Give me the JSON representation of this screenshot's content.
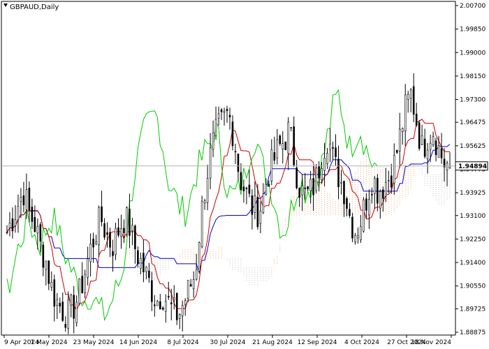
{
  "header": {
    "symbol_label": "GBPAUD,Daily"
  },
  "colors": {
    "background": "#ffffff",
    "tenkan_sen": "#cc0000",
    "kijun_sen": "#0000cc",
    "chikou_span": "#00cc00",
    "kumo_bull": "#e8a070",
    "kumo_bear": "#b8b8b8",
    "candle": "#000000",
    "current_price_line": "#b0b0b0"
  },
  "chart_data": {
    "type": "candlestick",
    "symbol": "GBPAUD",
    "timeframe": "Daily",
    "current_price": 1.94894,
    "current_price_label": "1.94894",
    "ylim": [
      1.88875,
      2.0075
    ],
    "y_ticks": [
      {
        "value": 2.007,
        "label": "2.00700"
      },
      {
        "value": 1.9985,
        "label": "1.99850"
      },
      {
        "value": 1.99,
        "label": "1.99000"
      },
      {
        "value": 1.9815,
        "label": "1.98150"
      },
      {
        "value": 1.973,
        "label": "1.97300"
      },
      {
        "value": 1.96475,
        "label": "1.96475"
      },
      {
        "value": 1.95625,
        "label": "1.95625"
      },
      {
        "value": 1.94775,
        "label": "1.94775"
      },
      {
        "value": 1.93925,
        "label": "1.93925"
      },
      {
        "value": 1.931,
        "label": "1.93100"
      },
      {
        "value": 1.9225,
        "label": "1.92250"
      },
      {
        "value": 1.914,
        "label": "1.91400"
      },
      {
        "value": 1.9055,
        "label": "1.90550"
      },
      {
        "value": 1.89725,
        "label": "1.89725"
      },
      {
        "value": 1.88875,
        "label": "1.88875"
      }
    ],
    "x_ticks": [
      {
        "label": "9 Apr 2024"
      },
      {
        "label": "1 May 2024"
      },
      {
        "label": "23 May 2024"
      },
      {
        "label": "14 Jun 2024"
      },
      {
        "label": "8 Jul 2024"
      },
      {
        "label": "30 Jul 2024"
      },
      {
        "label": "21 Aug 2024"
      },
      {
        "label": "12 Sep 2024"
      },
      {
        "label": "4 Oct 2024"
      },
      {
        "label": "27 Oct 2024"
      },
      {
        "label": "18 Nov 2024"
      }
    ],
    "close_path": [
      1.925,
      1.93,
      1.935,
      1.94,
      1.932,
      1.928,
      1.92,
      1.915,
      1.905,
      1.9,
      1.897,
      1.895,
      1.898,
      1.902,
      1.91,
      1.918,
      1.925,
      1.93,
      1.924,
      1.92,
      1.925,
      1.93,
      1.928,
      1.92,
      1.915,
      1.91,
      1.905,
      1.9,
      1.903,
      1.9,
      1.896,
      1.895,
      1.9,
      1.905,
      1.91,
      1.93,
      1.945,
      1.955,
      1.962,
      1.965,
      1.968,
      1.96,
      1.945,
      1.94,
      1.935,
      1.932,
      1.935,
      1.945,
      1.95,
      1.955,
      1.958,
      1.962,
      1.95,
      1.94,
      1.938,
      1.94,
      1.945,
      1.955,
      1.96,
      1.95,
      1.945,
      1.94,
      1.93,
      1.925,
      1.93,
      1.938,
      1.945,
      1.94,
      1.942,
      1.945,
      1.95,
      1.96,
      1.97,
      1.975,
      1.965,
      1.955,
      1.96,
      1.962,
      1.955,
      1.95,
      1.949
    ]
  }
}
